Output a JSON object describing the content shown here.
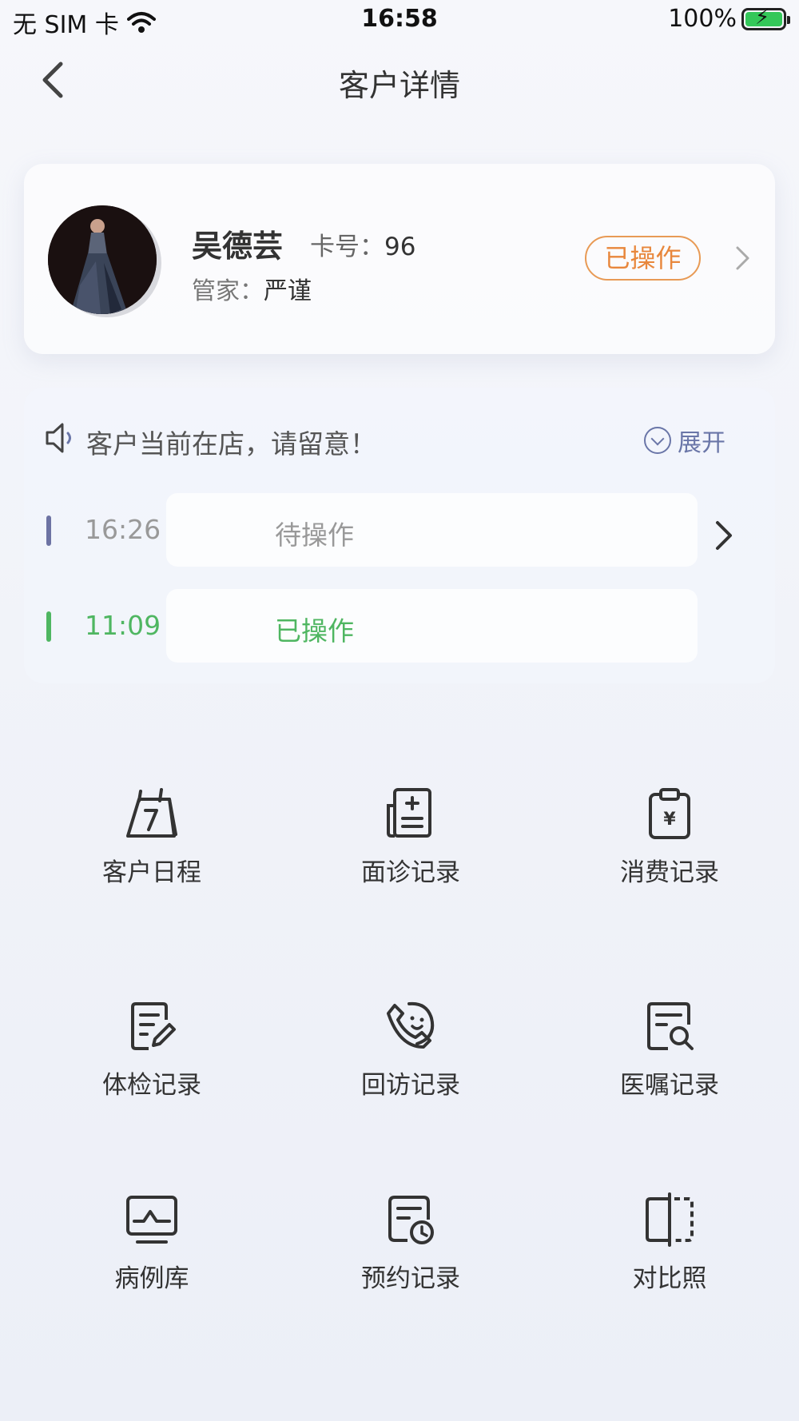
{
  "status_bar": {
    "carrier": "无 SIM 卡",
    "time": "16:58",
    "battery": "100%"
  },
  "nav": {
    "title": "客户详情"
  },
  "profile": {
    "name": "吴德芸",
    "card_label": "卡号：",
    "card_no": "96",
    "keeper_label": "管家：",
    "keeper": "严谨",
    "status": "已操作"
  },
  "notice": {
    "text": "客户当前在店，请留意！",
    "expand_label": "展开",
    "logs": [
      {
        "time": "16:26",
        "status": "待操作"
      },
      {
        "time": "11:09",
        "status": "已操作"
      }
    ]
  },
  "menu": [
    {
      "label": "客户日程",
      "icon": "calendar-icon"
    },
    {
      "label": "面诊记录",
      "icon": "medical-record-icon"
    },
    {
      "label": "消费记录",
      "icon": "payment-clipboard-icon"
    },
    {
      "label": "体检记录",
      "icon": "edit-document-icon"
    },
    {
      "label": "回访记录",
      "icon": "phone-call-icon"
    },
    {
      "label": "医嘱记录",
      "icon": "search-document-icon"
    },
    {
      "label": "病例库",
      "icon": "monitor-chart-icon"
    },
    {
      "label": "预约记录",
      "icon": "appointment-clock-icon"
    },
    {
      "label": "对比照",
      "icon": "compare-icon"
    }
  ],
  "colors": {
    "accent_orange": "#e8873c",
    "done_green": "#4fb661",
    "pending_bar": "#6d73a3",
    "link_blue": "#6a76a8"
  }
}
